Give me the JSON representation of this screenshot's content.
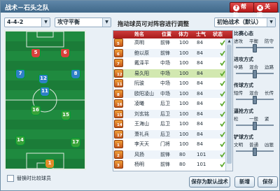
{
  "window": {
    "title": "战术－石头之队"
  },
  "titlebar": {
    "help_label": "帮助",
    "close_label": "关闭"
  },
  "controls": {
    "formation": "4-4-2",
    "tactic": "攻守平衡",
    "hint": "拖动球员可对阵容进行调整",
    "preset": "初始战术（默认）"
  },
  "pitch": {
    "players": [
      {
        "number": "5",
        "color": "#d9403c"
      },
      {
        "number": "6",
        "color": "#d9403c"
      },
      {
        "number": "7",
        "color": "#2f80c7"
      },
      {
        "number": "12",
        "color": "#2f80c7"
      },
      {
        "number": "11",
        "color": "#2f80c7"
      },
      {
        "number": "8",
        "color": "#2f80c7"
      },
      {
        "number": "16",
        "color": "#39a33a"
      },
      {
        "number": "15",
        "color": "#39a33a"
      },
      {
        "number": "14",
        "color": "#39a33a"
      },
      {
        "number": "17",
        "color": "#39a33a"
      },
      {
        "number": "1",
        "color": "#e28b2a"
      }
    ]
  },
  "swap": {
    "label": "替换时比较球员"
  },
  "table": {
    "headers": [
      "姓名",
      "位置",
      "体力",
      "士气",
      "状态"
    ],
    "rows": [
      {
        "no": "5",
        "name": "高明",
        "pos": "前锋",
        "stamina": "100",
        "morale": "84"
      },
      {
        "no": "6",
        "name": "鲍以原",
        "pos": "前锋",
        "stamina": "100",
        "morale": "84"
      },
      {
        "no": "7",
        "name": "戴泽平",
        "pos": "中场",
        "stamina": "100",
        "morale": "84"
      },
      {
        "no": "12",
        "name": "易久阳",
        "pos": "中场",
        "stamina": "100",
        "morale": "84"
      },
      {
        "no": "11",
        "name": "阮骏",
        "pos": "中场",
        "stamina": "100",
        "morale": "84"
      },
      {
        "no": "8",
        "name": "欧阳凌山",
        "pos": "中场",
        "stamina": "100",
        "morale": "84"
      },
      {
        "no": "16",
        "name": "凌曦",
        "pos": "后卫",
        "stamina": "100",
        "morale": "84"
      },
      {
        "no": "15",
        "name": "刘玄铭",
        "pos": "后卫",
        "stamina": "100",
        "morale": "84"
      },
      {
        "no": "14",
        "name": "王海山",
        "pos": "后卫",
        "stamina": "100",
        "morale": "84"
      },
      {
        "no": "17",
        "name": "萧礼兵",
        "pos": "后卫",
        "stamina": "100",
        "morale": "84"
      },
      {
        "no": "1",
        "name": "李天天",
        "pos": "门将",
        "stamina": "100",
        "morale": "84"
      },
      {
        "no": "2",
        "name": "风扬",
        "pos": "前锋",
        "stamina": "80",
        "morale": "101"
      },
      {
        "no": "3",
        "name": "杨明",
        "pos": "前锋",
        "stamina": "80",
        "morale": "101"
      }
    ]
  },
  "settings": [
    {
      "label": "比赛心态",
      "options": [
        "进攻",
        "平衡",
        "防守"
      ]
    },
    {
      "label": "进攻方式",
      "options": [
        "中路",
        "混合",
        "边路"
      ]
    },
    {
      "label": "传球方式",
      "options": [
        "短传",
        "混合",
        "长传"
      ]
    },
    {
      "label": "逼抢方式",
      "options": [
        "松",
        "一般",
        "紧"
      ]
    },
    {
      "label": "铲球方式",
      "options": [
        "文明",
        "普通",
        "凶狠"
      ]
    }
  ],
  "buttons": {
    "save_default": "保存为默认战术",
    "new": "新增",
    "save": "保存"
  },
  "colors": {
    "titlebar": "#4a7497",
    "header": "#b72626",
    "pitch": "#1f8a3f",
    "accent": "#c81f1f"
  }
}
